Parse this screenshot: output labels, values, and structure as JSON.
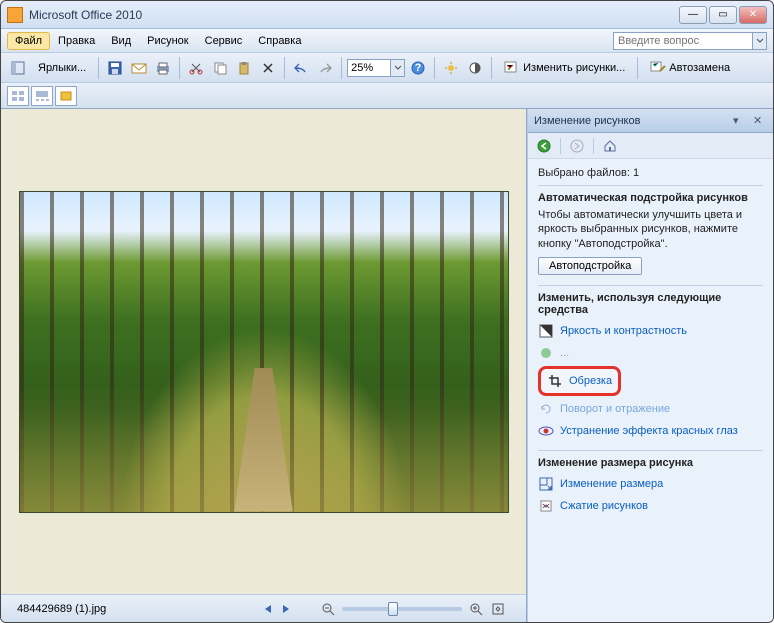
{
  "title": "Microsoft Office 2010",
  "menu": {
    "file": "Файл",
    "edit": "Правка",
    "view": "Вид",
    "picture": "Рисунок",
    "tools": "Сервис",
    "help": "Справка"
  },
  "question_placeholder": "Введите вопрос",
  "toolbar": {
    "shortcuts": "Ярлыки...",
    "zoom": "25%",
    "edit_pictures": "Изменить рисунки...",
    "autocorrect": "Автозамена"
  },
  "status": {
    "filename": "484429689 (1).jpg"
  },
  "taskpane": {
    "title": "Изменение рисунков",
    "selected": "Выбрано файлов: 1",
    "auto_section": "Автоматическая подстройка рисунков",
    "auto_desc": "Чтобы автоматически улучшить цвета и яркость выбранных рисунков, нажмите кнопку \"Автоподстройка\".",
    "auto_btn": "Автоподстройка",
    "tools_section": "Изменить, используя следующие средства",
    "brightness": "Яркость и контрастность",
    "color_partial": "Ц...",
    "crop": "Обрезка",
    "rotate_partial": "Поворот и отражение",
    "redeye": "Устранение эффекта красных глаз",
    "resize_section": "Изменение размера рисунка",
    "resize": "Изменение размера",
    "compress": "Сжатие рисунков"
  }
}
